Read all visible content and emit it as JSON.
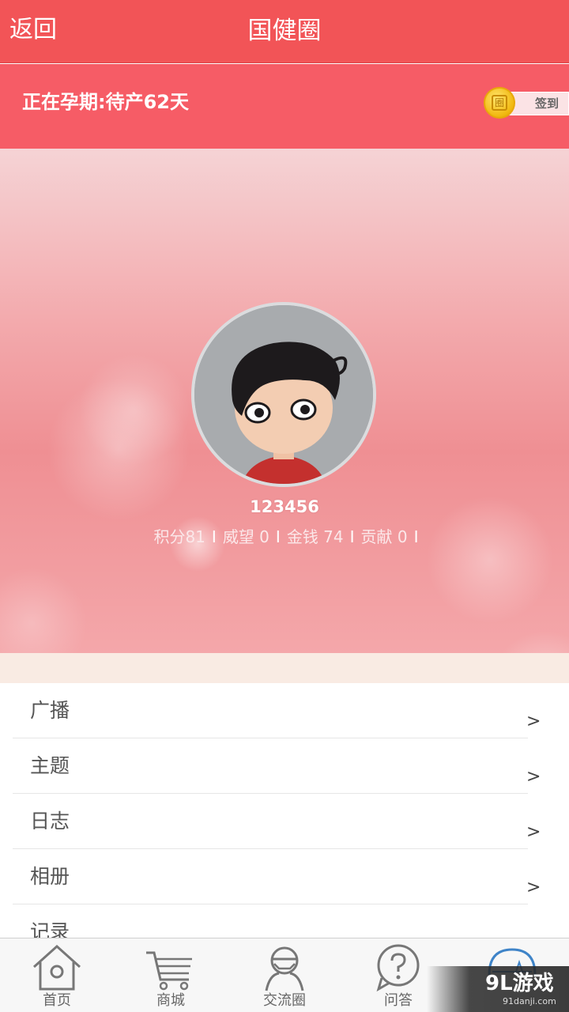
{
  "navbar": {
    "back_label": "返回",
    "title": "国健圈"
  },
  "status": {
    "text": "正在孕期:待产62天",
    "checkin_label": "签到",
    "coin_glyph": "圈"
  },
  "profile": {
    "username": "123456",
    "stats": [
      {
        "label": "积分81"
      },
      {
        "label": "威望 0"
      },
      {
        "label": "金钱 74"
      },
      {
        "label": "贡献 0"
      }
    ],
    "separator": "I"
  },
  "menu": {
    "items": [
      {
        "label": "广播",
        "arrow": ">"
      },
      {
        "label": "主题",
        "arrow": ">"
      },
      {
        "label": "日志",
        "arrow": ">"
      },
      {
        "label": "相册",
        "arrow": ">"
      },
      {
        "label": "记录",
        "arrow": ">"
      }
    ]
  },
  "tabbar": {
    "tabs": [
      {
        "label": "首页",
        "icon": "home-icon"
      },
      {
        "label": "商城",
        "icon": "cart-icon"
      },
      {
        "label": "交流圈",
        "icon": "community-icon"
      },
      {
        "label": "问答",
        "icon": "question-icon"
      },
      {
        "label": "",
        "icon": "profile-icon"
      }
    ]
  },
  "watermark": {
    "main": "9L游戏",
    "sub": "91danji.com"
  },
  "colors": {
    "nav": "#f25457",
    "status": "#f65c66",
    "accent": "#3f84c8"
  }
}
